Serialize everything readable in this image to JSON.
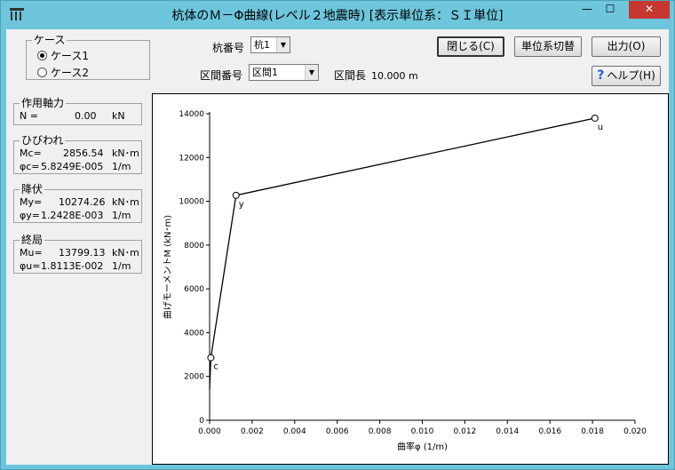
{
  "window": {
    "title": "杭体のＭ－Φ曲線(レベル２地震時) [表示単位系：ＳＩ単位]",
    "min_symbol": "—",
    "max_symbol": "☐",
    "close_symbol": "✕"
  },
  "case_group": {
    "legend": "ケース",
    "options": [
      {
        "label": "ケース1",
        "checked": true
      },
      {
        "label": "ケース2",
        "checked": false
      }
    ]
  },
  "pile": {
    "label": "杭番号",
    "value": "杭1"
  },
  "section": {
    "label": "区間番号",
    "value": "区間1",
    "length_label": "区間長",
    "length_value": "10.000 m"
  },
  "buttons": {
    "close": "閉じる(C)",
    "units": "単位系切替",
    "output": "出力(O)",
    "help": "ヘルプ(H)"
  },
  "axial": {
    "legend": "作用軸力",
    "label": "N =",
    "value": "0.00",
    "unit": "kN"
  },
  "crack": {
    "legend": "ひびわれ",
    "m_label": "Mc=",
    "m_value": "2856.54",
    "m_unit": "kN･m",
    "p_label": "φc=",
    "p_value": "5.8249E-005",
    "p_unit": "1/m"
  },
  "yield": {
    "legend": "降伏",
    "m_label": "My=",
    "m_value": "10274.26",
    "m_unit": "kN･m",
    "p_label": "φy=",
    "p_value": "1.2428E-003",
    "p_unit": "1/m"
  },
  "ultimate": {
    "legend": "終局",
    "m_label": "Mu=",
    "m_value": "13799.13",
    "m_unit": "kN･m",
    "p_label": "φu=",
    "p_value": "1.8113E-002",
    "p_unit": "1/m"
  },
  "chart_data": {
    "type": "line",
    "xlabel": "曲率φ (1/m)",
    "ylabel": "曲げモーメントM (kN･m)",
    "xlim": [
      0,
      0.02
    ],
    "ylim": [
      0,
      14000
    ],
    "xticks": [
      "0.000",
      "0.002",
      "0.004",
      "0.006",
      "0.008",
      "0.010",
      "0.012",
      "0.014",
      "0.016",
      "0.018",
      "0.020"
    ],
    "yticks": [
      "0",
      "2000",
      "4000",
      "6000",
      "8000",
      "10000",
      "12000",
      "14000"
    ],
    "series": [
      {
        "x": [
          0,
          5.8249e-05,
          0.0012428,
          0.018113
        ],
        "y": [
          1400,
          2856.54,
          10274.26,
          13799.13
        ]
      }
    ],
    "points": [
      {
        "label": "c",
        "x": 5.8249e-05,
        "y": 2856.54
      },
      {
        "label": "y",
        "x": 0.0012428,
        "y": 10274.26
      },
      {
        "label": "u",
        "x": 0.018113,
        "y": 13799.13
      }
    ],
    "grid": false,
    "line_color": "#000000"
  }
}
